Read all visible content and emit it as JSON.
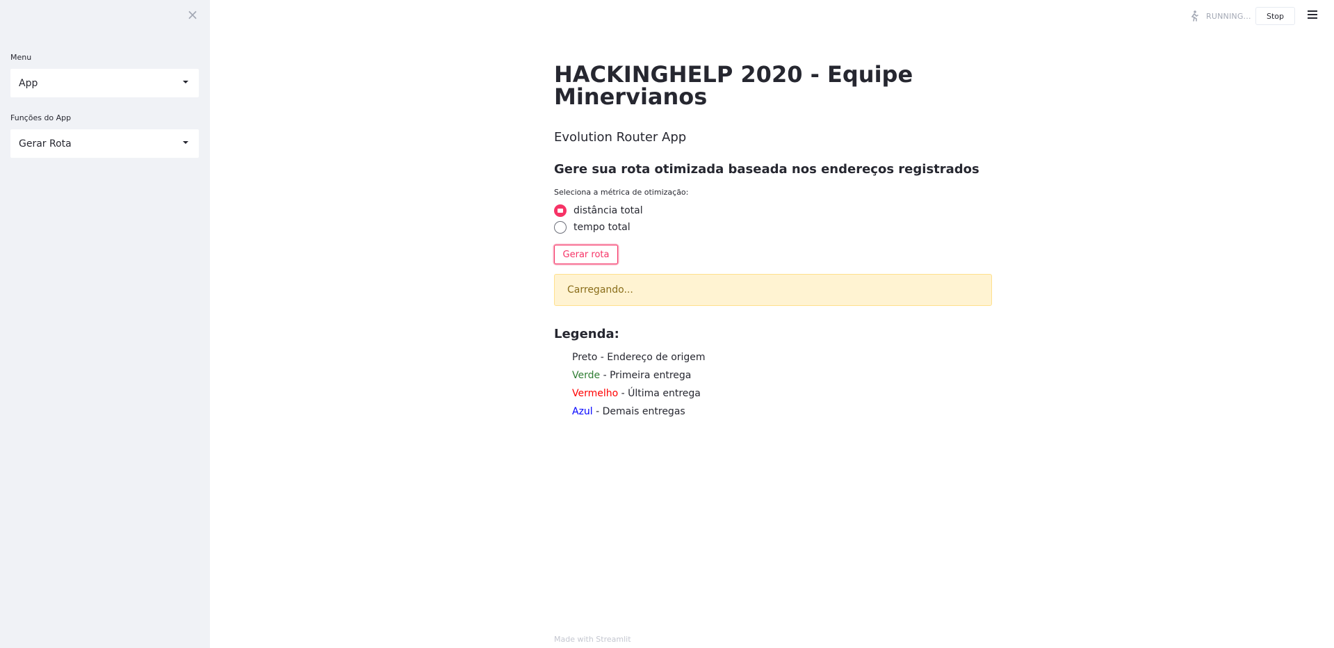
{
  "sidebar": {
    "close_glyph": "×",
    "menu_label": "Menu",
    "menu_value": "App",
    "functions_label": "Funções do App",
    "functions_value": "Gerar Rota"
  },
  "topbar": {
    "status_text": "RUNNING...",
    "stop_label": "Stop"
  },
  "main": {
    "title": "HACKINGHELP 2020 - Equipe Minervianos",
    "subtitle": "Evolution Router App",
    "heading": "Gere sua rota otimizada baseada nos endereços registrados",
    "radio_label": "Seleciona a métrica de otimização:",
    "radio_options": [
      {
        "label": "distância total",
        "checked": true
      },
      {
        "label": "tempo total",
        "checked": false
      }
    ],
    "button_label": "Gerar rota",
    "alert_text": "Carregando...",
    "legend_title": "Legenda:",
    "legend": [
      {
        "color_name": "Preto",
        "color": "#262730",
        "desc": " - Endereço de origem"
      },
      {
        "color_name": "Verde",
        "color": "#2e7d32",
        "desc": " - Primeira entrega"
      },
      {
        "color_name": "Vermelho",
        "color": "#ff0000",
        "desc": " - Última entrega"
      },
      {
        "color_name": "Azul",
        "color": "#0000ff",
        "desc": " - Demais entregas"
      }
    ]
  },
  "footer": {
    "text": "Made with Streamlit"
  },
  "colors": {
    "primary": "#f63366",
    "sidebar_bg": "#f0f2f6",
    "alert_bg": "#fff3d2"
  }
}
